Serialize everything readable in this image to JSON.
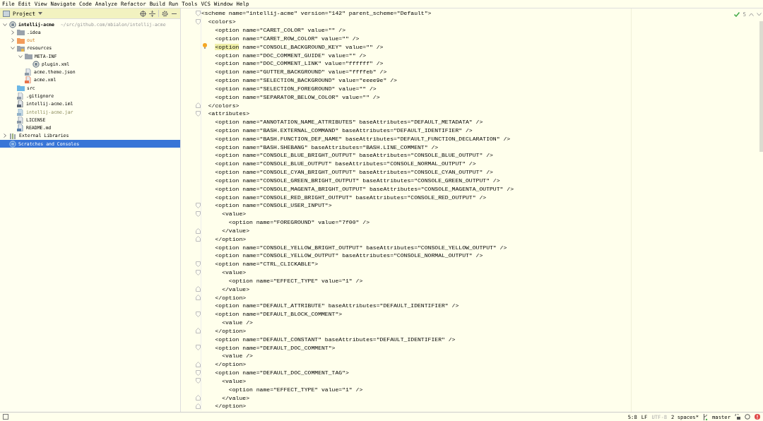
{
  "menu": [
    "File",
    "Edit",
    "View",
    "Navigate",
    "Code",
    "Analyze",
    "Refactor",
    "Build",
    "Run",
    "Tools",
    "VCS",
    "Window",
    "Help"
  ],
  "project_panel": {
    "title": "Project",
    "tree": [
      {
        "label": "intellij-acme",
        "hint": "~/src/github.com/mbialon/intellij-acme",
        "kind": "module",
        "expanded": true,
        "selected": false,
        "children": [
          {
            "label": ".idea",
            "kind": "folder",
            "expanded": false,
            "selected": false
          },
          {
            "label": "out",
            "kind": "excluded",
            "expanded": false,
            "selected": false
          },
          {
            "label": "resources",
            "kind": "resources",
            "expanded": true,
            "selected": false,
            "children": [
              {
                "label": "META-INF",
                "kind": "folder",
                "expanded": true,
                "selected": false,
                "children": [
                  {
                    "label": "plugin.xml",
                    "kind": "plugin",
                    "selected": false
                  }
                ]
              },
              {
                "label": "acme.theme.json",
                "kind": "json",
                "selected": false
              },
              {
                "label": "acme.xml",
                "kind": "xml",
                "selected": false
              }
            ]
          },
          {
            "label": "src",
            "kind": "source",
            "selected": false
          },
          {
            "label": ".gitignore",
            "kind": "text",
            "selected": false
          },
          {
            "label": "intellij-acme.iml",
            "kind": "iml",
            "selected": false
          },
          {
            "label": "intellij-acme.jar",
            "kind": "jar",
            "selected": false
          },
          {
            "label": "LICENSE",
            "kind": "text",
            "selected": false
          },
          {
            "label": "README.md",
            "kind": "markdown",
            "selected": false
          }
        ]
      },
      {
        "label": "External Libraries",
        "kind": "libraries",
        "expanded": false,
        "selected": false
      },
      {
        "label": "Scratches and Consoles",
        "kind": "scratches",
        "selected": true
      }
    ]
  },
  "editor": {
    "inspection_count": "5",
    "lines": [
      {
        "text": "<scheme name=\"intellij-acme\" version=\"142\" parent_scheme=\"Default\">",
        "kind": "fold_start"
      },
      {
        "text": "  <colors>",
        "kind": "fold_start"
      },
      {
        "text": "    <option name=\"CARET_COLOR\" value=\"\" />",
        "kind": "plain"
      },
      {
        "text": "    <option name=\"CARET_ROW_COLOR\" value=\"\" />",
        "kind": "plain"
      },
      {
        "parts": [
          {
            "text": "<option",
            "highlighted": true
          },
          {
            "text": " name=\"CONSOLE_BACKGROUND_KEY\" value=\"\" />",
            "highlighted": false
          }
        ],
        "kind": "intention"
      },
      {
        "text": "    <option name=\"DOC_COMMENT_GUIDE\" value=\"\" />",
        "kind": "plain"
      },
      {
        "text": "    <option name=\"DOC_COMMENT_LINK\" value=\"ffffff\" />",
        "kind": "plain"
      },
      {
        "text": "    <option name=\"GUTTER_BACKGROUND\" value=\"ffffeb\" />",
        "kind": "plain"
      },
      {
        "text": "    <option name=\"SELECTION_BACKGROUND\" value=\"eeee9e\" />",
        "kind": "plain"
      },
      {
        "text": "    <option name=\"SELECTION_FOREGROUND\" value=\"\" />",
        "kind": "plain"
      },
      {
        "text": "    <option name=\"SEPARATOR_BELOW_COLOR\" value=\"\" />",
        "kind": "plain"
      },
      {
        "text": "  </colors>",
        "kind": "fold_end"
      },
      {
        "text": "  <attributes>",
        "kind": "fold_start"
      },
      {
        "text": "    <option name=\"ANNOTATION_NAME_ATTRIBUTES\" baseAttributes=\"DEFAULT_METADATA\" />",
        "kind": "plain"
      },
      {
        "text": "    <option name=\"BASH.EXTERNAL_COMMAND\" baseAttributes=\"DEFAULT_IDENTIFIER\" />",
        "kind": "plain"
      },
      {
        "text": "    <option name=\"BASH.FUNCTION_DEF_NAME\" baseAttributes=\"DEFAULT_FUNCTION_DECLARATION\" />",
        "kind": "plain"
      },
      {
        "text": "    <option name=\"BASH.SHEBANG\" baseAttributes=\"BASH.LINE_COMMENT\" />",
        "kind": "plain"
      },
      {
        "text": "    <option name=\"CONSOLE_BLUE_BRIGHT_OUTPUT\" baseAttributes=\"CONSOLE_BLUE_OUTPUT\" />",
        "kind": "plain"
      },
      {
        "text": "    <option name=\"CONSOLE_BLUE_OUTPUT\" baseAttributes=\"CONSOLE_NORMAL_OUTPUT\" />",
        "kind": "plain"
      },
      {
        "text": "    <option name=\"CONSOLE_CYAN_BRIGHT_OUTPUT\" baseAttributes=\"CONSOLE_CYAN_OUTPUT\" />",
        "kind": "plain"
      },
      {
        "text": "    <option name=\"CONSOLE_GREEN_BRIGHT_OUTPUT\" baseAttributes=\"CONSOLE_GREEN_OUTPUT\" />",
        "kind": "plain"
      },
      {
        "text": "    <option name=\"CONSOLE_MAGENTA_BRIGHT_OUTPUT\" baseAttributes=\"CONSOLE_MAGENTA_OUTPUT\" />",
        "kind": "plain"
      },
      {
        "text": "    <option name=\"CONSOLE_RED_BRIGHT_OUTPUT\" baseAttributes=\"CONSOLE_RED_OUTPUT\" />",
        "kind": "plain"
      },
      {
        "text": "    <option name=\"CONSOLE_USER_INPUT\">",
        "kind": "fold_start"
      },
      {
        "text": "      <value>",
        "kind": "fold_start"
      },
      {
        "text": "        <option name=\"FOREGROUND\" value=\"7f00\" />",
        "kind": "plain"
      },
      {
        "text": "      </value>",
        "kind": "fold_end"
      },
      {
        "text": "    </option>",
        "kind": "fold_end"
      },
      {
        "text": "    <option name=\"CONSOLE_YELLOW_BRIGHT_OUTPUT\" baseAttributes=\"CONSOLE_YELLOW_OUTPUT\" />",
        "kind": "plain"
      },
      {
        "text": "    <option name=\"CONSOLE_YELLOW_OUTPUT\" baseAttributes=\"CONSOLE_NORMAL_OUTPUT\" />",
        "kind": "plain"
      },
      {
        "text": "    <option name=\"CTRL_CLICKABLE\">",
        "kind": "fold_start"
      },
      {
        "text": "      <value>",
        "kind": "fold_start"
      },
      {
        "text": "        <option name=\"EFFECT_TYPE\" value=\"1\" />",
        "kind": "plain"
      },
      {
        "text": "      </value>",
        "kind": "fold_end"
      },
      {
        "text": "    </option>",
        "kind": "fold_end"
      },
      {
        "text": "    <option name=\"DEFAULT_ATTRIBUTE\" baseAttributes=\"DEFAULT_IDENTIFIER\" />",
        "kind": "plain"
      },
      {
        "text": "    <option name=\"DEFAULT_BLOCK_COMMENT\">",
        "kind": "fold_start"
      },
      {
        "text": "      <value />",
        "kind": "plain"
      },
      {
        "text": "    </option>",
        "kind": "fold_end"
      },
      {
        "text": "    <option name=\"DEFAULT_CONSTANT\" baseAttributes=\"DEFAULT_IDENTIFIER\" />",
        "kind": "plain"
      },
      {
        "text": "    <option name=\"DEFAULT_DOC_COMMENT\">",
        "kind": "fold_start"
      },
      {
        "text": "      <value />",
        "kind": "plain"
      },
      {
        "text": "    </option>",
        "kind": "fold_end"
      },
      {
        "text": "    <option name=\"DEFAULT_DOC_COMMENT_TAG\">",
        "kind": "fold_start"
      },
      {
        "text": "      <value>",
        "kind": "fold_start"
      },
      {
        "text": "        <option name=\"EFFECT_TYPE\" value=\"1\" />",
        "kind": "plain"
      },
      {
        "text": "      </value>",
        "kind": "fold_end"
      },
      {
        "text": "    </option>",
        "kind": "fold_end"
      }
    ]
  },
  "status_bar": {
    "position": "5:8",
    "line_separator": "LF",
    "encoding": {
      "text": "UTF-8",
      "disabled": true
    },
    "indent": "2 spaces*",
    "branch": "master"
  }
}
